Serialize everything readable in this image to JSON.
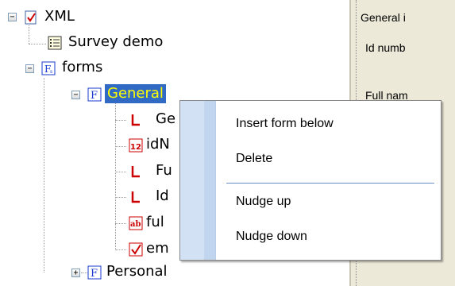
{
  "tree": {
    "xml_label": "XML",
    "survey_label": "Survey demo",
    "forms_label": "forms",
    "general_label": "General",
    "children": [
      "Ge",
      "idN",
      "Fu",
      "Id",
      "ful",
      "em"
    ],
    "personal_label": "Personal"
  },
  "right_panel": {
    "title": "General i",
    "line1": "Id numb",
    "line2": "Full nam"
  },
  "context_menu": {
    "items": [
      "Insert form below",
      "Delete",
      "Nudge up",
      "Nudge down"
    ]
  },
  "icons": {
    "number_glyph": "12",
    "text_glyph": "ab",
    "form_glyph": "F"
  },
  "colors": {
    "selection_bg": "#316ac5",
    "selection_text": "#ffff00",
    "menu_gutter": "#d3e1f4",
    "icon_red": "#cc0000",
    "icon_blue": "#1a3bd1"
  }
}
